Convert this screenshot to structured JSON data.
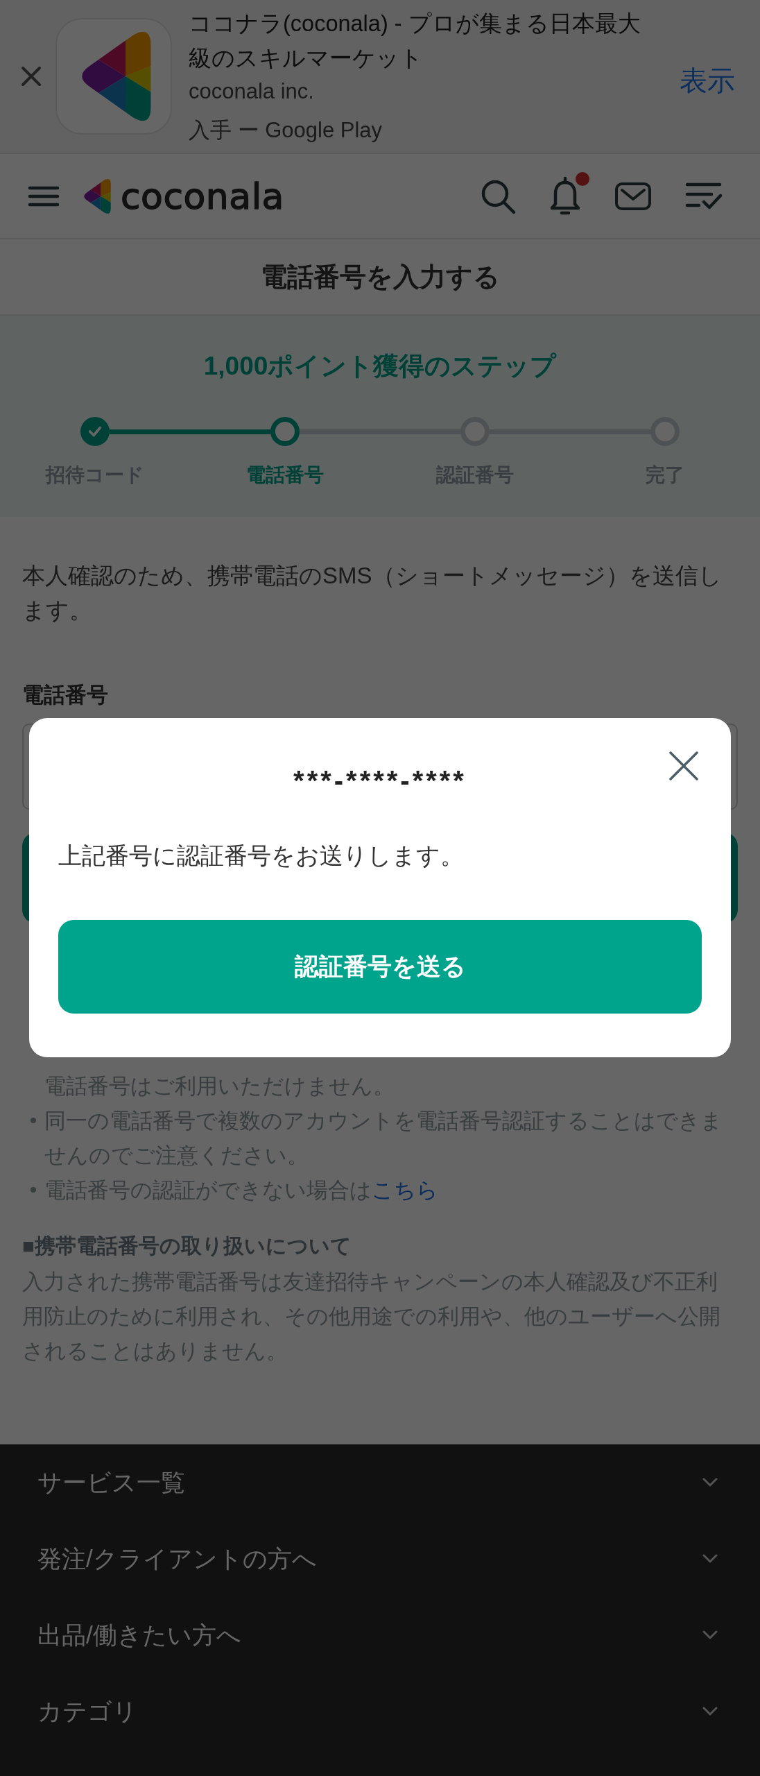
{
  "app_banner": {
    "title": "ココナラ(coconala) - プロが集まる日本最大級のスキルマーケット",
    "publisher": "coconala inc.",
    "store": "入手 ー Google Play",
    "action": "表示"
  },
  "header": {
    "logo_text": "coconala",
    "has_notification": true
  },
  "page_title": "電話番号を入力する",
  "steps": {
    "title": "1,000ポイント獲得のステップ",
    "items": [
      {
        "label": "招待コード",
        "completed": true,
        "current": false
      },
      {
        "label": "電話番号",
        "completed": false,
        "current": true
      },
      {
        "label": "認証番号",
        "completed": false,
        "current": false
      },
      {
        "label": "完了",
        "completed": false,
        "current": false
      }
    ]
  },
  "intro": "本人確認のため、携帯電話のSMS（ショートメッセージ）を送信します。",
  "phone_field": {
    "label": "電話番号"
  },
  "notes": [
    {
      "kind": "continuation",
      "text": "電話番号はご利用いただけません。"
    },
    {
      "kind": "bullet",
      "text": "同一の電話番号で複数のアカウントを電話番号認証することはできませんのでご注意ください。"
    },
    {
      "kind": "bullet",
      "text": "電話番号の認証ができない場合は",
      "link": "こちら"
    }
  ],
  "privacy": {
    "heading": "■携帯電話番号の取り扱いについて",
    "text": "入力された携帯電話番号は友達招待キャンペーンの本人確認及び不正利用防止のために利用され、その他用途での利用や、他のユーザーへ公開されることはありません。"
  },
  "dialog": {
    "phone": "***-****-****",
    "message": "上記番号に認証番号をお送りします。",
    "button": "認証番号を送る"
  },
  "footer_menu": [
    {
      "label": "サービス一覧",
      "expanded": false
    },
    {
      "label": "発注/クライアントの方へ",
      "expanded": false
    },
    {
      "label": "出品/働きたい方へ",
      "expanded": false
    },
    {
      "label": "カテゴリ",
      "expanded": false
    }
  ]
}
